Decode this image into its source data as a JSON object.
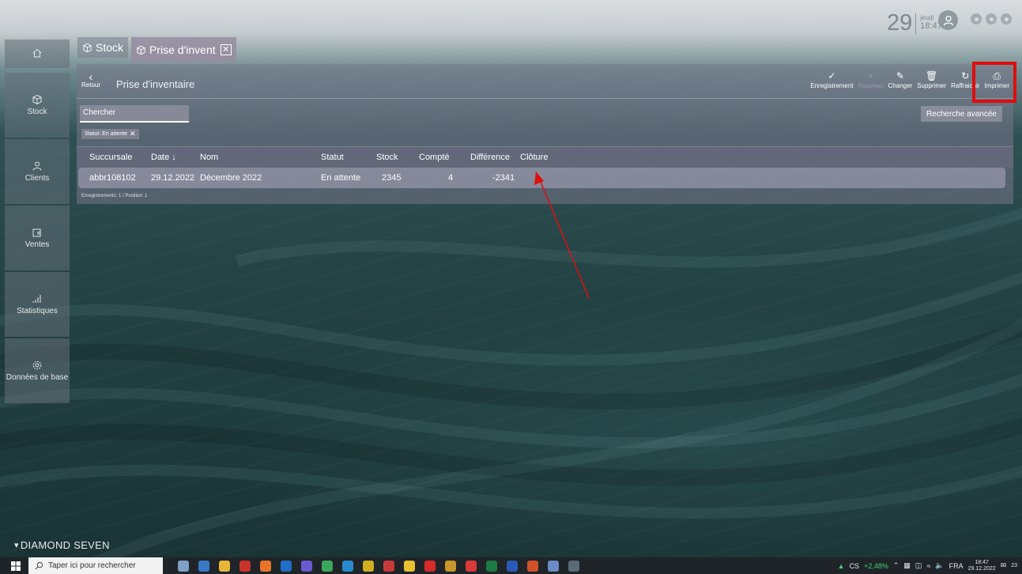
{
  "clock": {
    "day": "29",
    "weekday": "jeudi",
    "time": "18:47:57"
  },
  "tabs": [
    {
      "label": "Stock"
    },
    {
      "label": "Prise d'invent",
      "close": "✕"
    }
  ],
  "sidebar": {
    "items": [
      {
        "label": ""
      },
      {
        "label": "Stock"
      },
      {
        "label": "Clients"
      },
      {
        "label": "Ventes"
      },
      {
        "label": "Statistiques"
      },
      {
        "label": "Données de base"
      }
    ]
  },
  "toolbar": {
    "back": "Retour",
    "title": "Prise d'inventaire",
    "actions": [
      {
        "label": "Enregistrement",
        "icon": "check-icon",
        "enabled": true
      },
      {
        "label": "Nouveau",
        "icon": "plus-icon",
        "enabled": false
      },
      {
        "label": "Changer",
        "icon": "pencil-icon",
        "enabled": true
      },
      {
        "label": "Supprimer",
        "icon": "trash-icon",
        "enabled": true
      },
      {
        "label": "Raffraichir",
        "icon": "refresh-icon",
        "enabled": true
      },
      {
        "label": "Imprimer",
        "icon": "printer-icon",
        "enabled": true
      }
    ]
  },
  "search": {
    "placeholder": "Chercher",
    "advanced": "Recherche avancée"
  },
  "filter_chip": {
    "label": "Statut: En attente"
  },
  "grid": {
    "columns": [
      "Succursale",
      "Date ↓",
      "Nom",
      "Statut",
      "Stock",
      "Compté",
      "Différence",
      "Clôture"
    ],
    "rows": [
      [
        "abbr108102",
        "29.12.2022",
        "Décembre 2022",
        "En attente",
        "2345",
        "4",
        "-2341",
        ""
      ]
    ],
    "footer": "Enregistrements: 1 / Position: 1"
  },
  "brand": "DIAMOND SEVEN",
  "taskbar": {
    "search_placeholder": "Taper ici pour rechercher",
    "stock_ticker": "CS",
    "stock_change": "+2,48%",
    "lang": "FRA",
    "time": "18:47",
    "date": "29.12.2022",
    "notif": "23"
  },
  "colors": {
    "highlight": "#e00d0d",
    "arrow": "#e00d0d",
    "accent_green": "#3dd36b"
  }
}
